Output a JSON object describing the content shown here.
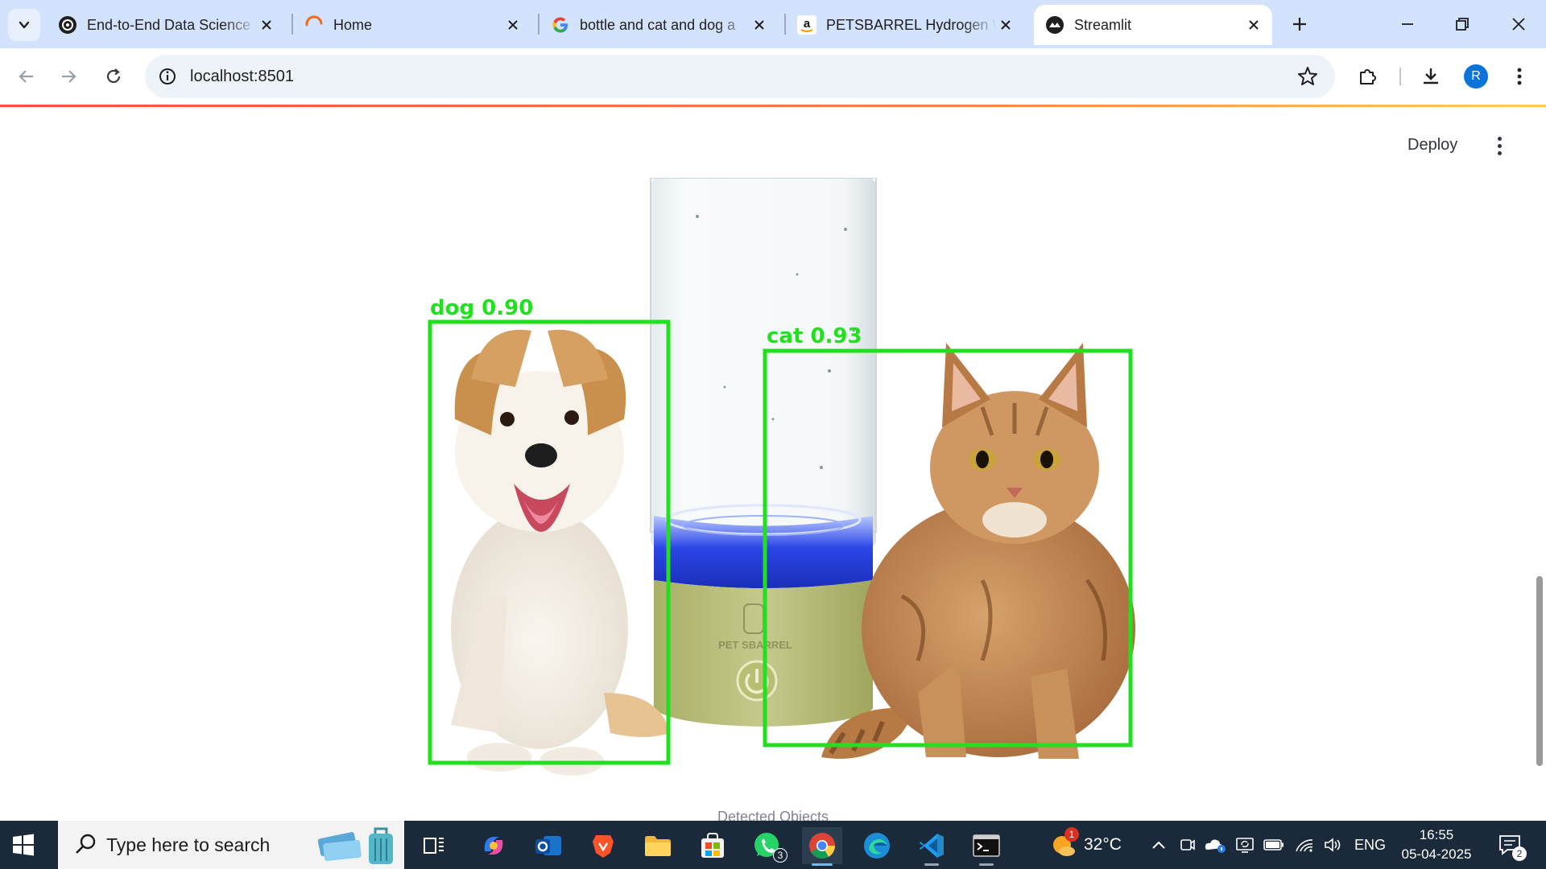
{
  "browser": {
    "tabs": [
      {
        "title": "End-to-End Data Science",
        "favicon": "openai-icon",
        "active": false
      },
      {
        "title": "Home",
        "favicon": "loading-spinner-icon",
        "active": false
      },
      {
        "title": "bottle and cat and dog a",
        "favicon": "google-icon",
        "active": false
      },
      {
        "title": "PETSBARREL Hydrogen W",
        "favicon": "amazon-icon",
        "active": false
      },
      {
        "title": "Streamlit",
        "favicon": "streamlit-icon",
        "active": true
      }
    ],
    "url": "localhost:8501",
    "profile_initial": "R"
  },
  "app": {
    "deploy_label": "Deploy",
    "detections": [
      {
        "label": "dog 0.90",
        "class": "dog",
        "confidence": 0.9
      },
      {
        "label": "cat 0.93",
        "class": "cat",
        "confidence": 0.93
      }
    ],
    "bottle_brand_text": "PET SBARREL",
    "caption": "Detected Objects",
    "box_color": "#22e01f"
  },
  "taskbar": {
    "search_placeholder": "Type here to search",
    "whatsapp_badge": "3",
    "weather_badge": "1",
    "temperature": "32°C",
    "language": "ENG",
    "time": "16:55",
    "date": "05-04-2025",
    "notifications_count": "2"
  }
}
